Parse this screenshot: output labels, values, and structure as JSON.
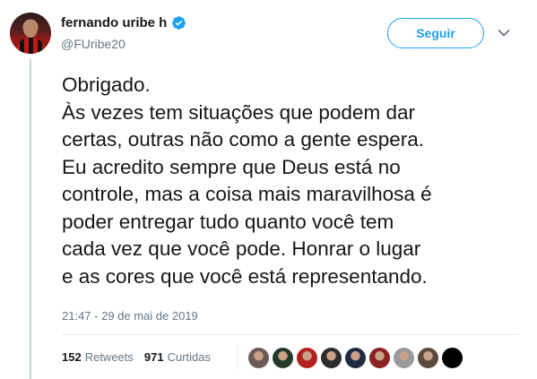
{
  "user": {
    "display_name": "fernando uribe h",
    "handle": "@FUribe20",
    "verified_icon": "verified-badge-icon",
    "avatar_icon": "profile-photo"
  },
  "follow_button": {
    "label": "Seguir"
  },
  "menu_icon": "chevron-down-icon",
  "tweet": {
    "lines": [
      "Obrigado.",
      "Às vezes tem situações que podem dar",
      "certas, outras não como a gente espera.",
      "Eu acredito sempre que Deus está no",
      "controle, mas a coisa mais maravilhosa é",
      "poder entregar tudo quanto você tem",
      "cada vez que você pode. Honrar o lugar",
      "e as cores que você está representando."
    ],
    "timestamp": "21:47 - 29 de mai de 2019"
  },
  "stats": {
    "retweets_count": "152",
    "retweets_label": "Retweets",
    "likes_count": "971",
    "likes_label": "Curtidas"
  },
  "likers": [
    {
      "color": "#6b5a55"
    },
    {
      "color": "#233a2a"
    },
    {
      "color": "#b32020"
    },
    {
      "color": "#2c2c2c"
    },
    {
      "color": "#1f2a44"
    },
    {
      "color": "#8a2222"
    },
    {
      "color": "#9a9a9a"
    },
    {
      "color": "#5a4a3a"
    },
    {
      "color": "#000000"
    }
  ],
  "colors": {
    "accent": "#1da1f2",
    "muted": "#657786",
    "text": "#14171a"
  }
}
